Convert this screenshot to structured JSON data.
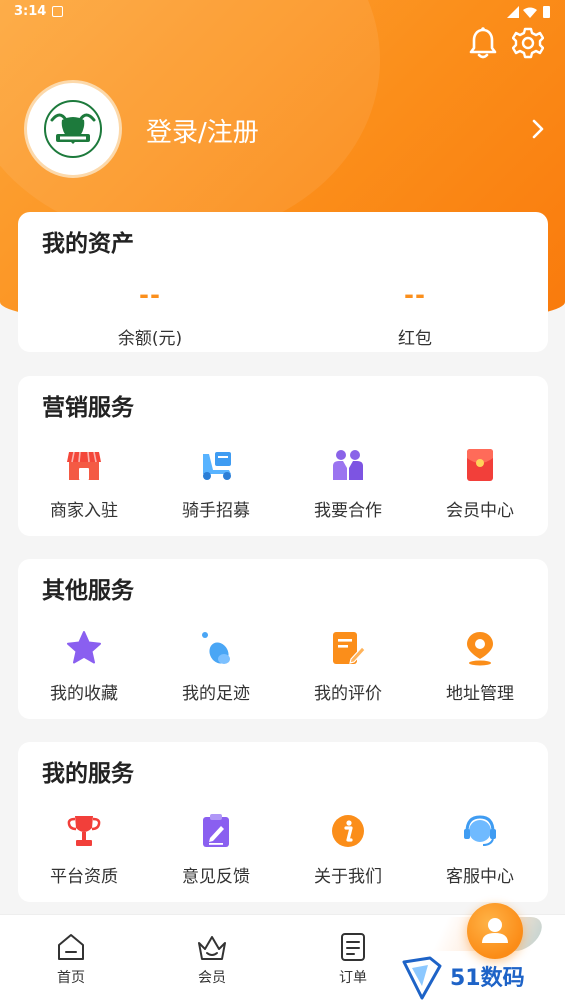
{
  "status_bar": {
    "time": "3:14"
  },
  "header": {
    "login_label": "登录/注册",
    "brand_color": "#fb8e1a"
  },
  "assets": {
    "title": "我的资产",
    "balance_value": "--",
    "balance_label": "余额(元)",
    "redpacket_value": "--",
    "redpacket_label": "红包"
  },
  "marketing": {
    "title": "营销服务",
    "items": [
      {
        "label": "商家入驻",
        "icon": "store-icon"
      },
      {
        "label": "骑手招募",
        "icon": "delivery-scooter-icon"
      },
      {
        "label": "我要合作",
        "icon": "partners-icon"
      },
      {
        "label": "会员中心",
        "icon": "red-envelope-icon"
      }
    ]
  },
  "other": {
    "title": "其他服务",
    "items": [
      {
        "label": "我的收藏",
        "icon": "star-icon"
      },
      {
        "label": "我的足迹",
        "icon": "footprint-icon"
      },
      {
        "label": "我的评价",
        "icon": "review-edit-icon"
      },
      {
        "label": "地址管理",
        "icon": "location-pin-icon"
      }
    ]
  },
  "mine": {
    "title": "我的服务",
    "items": [
      {
        "label": "平台资质",
        "icon": "trophy-icon"
      },
      {
        "label": "意见反馈",
        "icon": "feedback-clipboard-icon"
      },
      {
        "label": "关于我们",
        "icon": "info-icon"
      },
      {
        "label": "客服中心",
        "icon": "headset-icon"
      }
    ]
  },
  "bottom_nav": {
    "items": [
      {
        "label": "首页",
        "icon": "home-icon"
      },
      {
        "label": "会员",
        "icon": "crown-basket-icon"
      },
      {
        "label": "订单",
        "icon": "order-list-icon"
      }
    ]
  },
  "watermark": {
    "text": "51数码"
  }
}
